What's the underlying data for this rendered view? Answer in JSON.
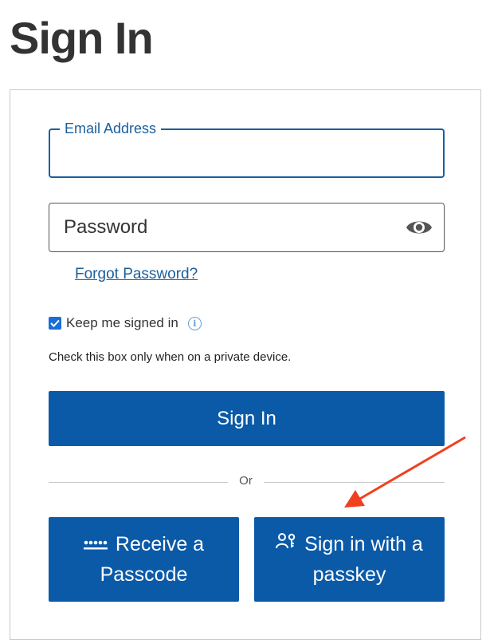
{
  "page": {
    "title": "Sign In"
  },
  "form": {
    "email_label": "Email Address",
    "email_value": "",
    "password_placeholder": "Password",
    "password_value": "",
    "forgot_password_label": "Forgot Password?",
    "keep_signed_in_label": "Keep me signed in",
    "keep_signed_in_checked": true,
    "private_device_note": "Check this box only when on a private device.",
    "sign_in_label": "Sign In",
    "divider_label": "Or"
  },
  "alternatives": {
    "passcode_line1": "Receive a",
    "passcode_line2": "Passcode",
    "passkey_line1": "Sign in with a",
    "passkey_line2": "passkey"
  },
  "icons": {
    "password_toggle": "eye-icon",
    "info": "info-icon",
    "passcode": "dots-icon",
    "passkey": "passkey-person-key-icon",
    "annotation": "red-arrow-icon"
  },
  "colors": {
    "primary": "#0b5aa8",
    "focus_border": "#1a5f9e",
    "link": "#1a5f9e",
    "annotation_arrow": "#f0401e"
  }
}
